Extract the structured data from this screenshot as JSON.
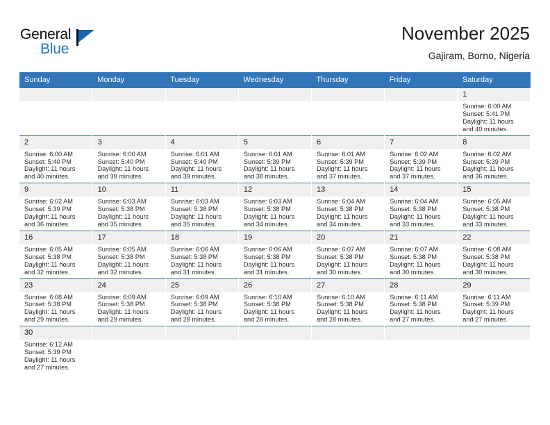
{
  "brand": {
    "name_primary": "General",
    "name_secondary": "Blue",
    "flag_icon": "flag-triangle-icon"
  },
  "header": {
    "title": "November 2025",
    "subtitle": "Gajiram, Borno, Nigeria"
  },
  "calendar": {
    "weekday_headers": [
      "Sunday",
      "Monday",
      "Tuesday",
      "Wednesday",
      "Thursday",
      "Friday",
      "Saturday"
    ],
    "accent_color": "#3275b8",
    "daynum_background": "#efefef",
    "weeks": [
      [
        {
          "day": "",
          "sunrise": "",
          "sunset": "",
          "daylight_line1": "",
          "daylight_line2": "",
          "empty": true
        },
        {
          "day": "",
          "sunrise": "",
          "sunset": "",
          "daylight_line1": "",
          "daylight_line2": "",
          "empty": true
        },
        {
          "day": "",
          "sunrise": "",
          "sunset": "",
          "daylight_line1": "",
          "daylight_line2": "",
          "empty": true
        },
        {
          "day": "",
          "sunrise": "",
          "sunset": "",
          "daylight_line1": "",
          "daylight_line2": "",
          "empty": true
        },
        {
          "day": "",
          "sunrise": "",
          "sunset": "",
          "daylight_line1": "",
          "daylight_line2": "",
          "empty": true
        },
        {
          "day": "",
          "sunrise": "",
          "sunset": "",
          "daylight_line1": "",
          "daylight_line2": "",
          "empty": true
        },
        {
          "day": "1",
          "sunrise": "Sunrise: 6:00 AM",
          "sunset": "Sunset: 5:41 PM",
          "daylight_line1": "Daylight: 11 hours",
          "daylight_line2": "and 40 minutes.",
          "empty": false
        }
      ],
      [
        {
          "day": "2",
          "sunrise": "Sunrise: 6:00 AM",
          "sunset": "Sunset: 5:40 PM",
          "daylight_line1": "Daylight: 11 hours",
          "daylight_line2": "and 40 minutes.",
          "empty": false
        },
        {
          "day": "3",
          "sunrise": "Sunrise: 6:00 AM",
          "sunset": "Sunset: 5:40 PM",
          "daylight_line1": "Daylight: 11 hours",
          "daylight_line2": "and 39 minutes.",
          "empty": false
        },
        {
          "day": "4",
          "sunrise": "Sunrise: 6:01 AM",
          "sunset": "Sunset: 5:40 PM",
          "daylight_line1": "Daylight: 11 hours",
          "daylight_line2": "and 39 minutes.",
          "empty": false
        },
        {
          "day": "5",
          "sunrise": "Sunrise: 6:01 AM",
          "sunset": "Sunset: 5:39 PM",
          "daylight_line1": "Daylight: 11 hours",
          "daylight_line2": "and 38 minutes.",
          "empty": false
        },
        {
          "day": "6",
          "sunrise": "Sunrise: 6:01 AM",
          "sunset": "Sunset: 5:39 PM",
          "daylight_line1": "Daylight: 11 hours",
          "daylight_line2": "and 37 minutes.",
          "empty": false
        },
        {
          "day": "7",
          "sunrise": "Sunrise: 6:02 AM",
          "sunset": "Sunset: 5:39 PM",
          "daylight_line1": "Daylight: 11 hours",
          "daylight_line2": "and 37 minutes.",
          "empty": false
        },
        {
          "day": "8",
          "sunrise": "Sunrise: 6:02 AM",
          "sunset": "Sunset: 5:39 PM",
          "daylight_line1": "Daylight: 11 hours",
          "daylight_line2": "and 36 minutes.",
          "empty": false
        }
      ],
      [
        {
          "day": "9",
          "sunrise": "Sunrise: 6:02 AM",
          "sunset": "Sunset: 5:39 PM",
          "daylight_line1": "Daylight: 11 hours",
          "daylight_line2": "and 36 minutes.",
          "empty": false
        },
        {
          "day": "10",
          "sunrise": "Sunrise: 6:03 AM",
          "sunset": "Sunset: 5:38 PM",
          "daylight_line1": "Daylight: 11 hours",
          "daylight_line2": "and 35 minutes.",
          "empty": false
        },
        {
          "day": "11",
          "sunrise": "Sunrise: 6:03 AM",
          "sunset": "Sunset: 5:38 PM",
          "daylight_line1": "Daylight: 11 hours",
          "daylight_line2": "and 35 minutes.",
          "empty": false
        },
        {
          "day": "12",
          "sunrise": "Sunrise: 6:03 AM",
          "sunset": "Sunset: 5:38 PM",
          "daylight_line1": "Daylight: 11 hours",
          "daylight_line2": "and 34 minutes.",
          "empty": false
        },
        {
          "day": "13",
          "sunrise": "Sunrise: 6:04 AM",
          "sunset": "Sunset: 5:38 PM",
          "daylight_line1": "Daylight: 11 hours",
          "daylight_line2": "and 34 minutes.",
          "empty": false
        },
        {
          "day": "14",
          "sunrise": "Sunrise: 6:04 AM",
          "sunset": "Sunset: 5:38 PM",
          "daylight_line1": "Daylight: 11 hours",
          "daylight_line2": "and 33 minutes.",
          "empty": false
        },
        {
          "day": "15",
          "sunrise": "Sunrise: 6:05 AM",
          "sunset": "Sunset: 5:38 PM",
          "daylight_line1": "Daylight: 11 hours",
          "daylight_line2": "and 33 minutes.",
          "empty": false
        }
      ],
      [
        {
          "day": "16",
          "sunrise": "Sunrise: 6:05 AM",
          "sunset": "Sunset: 5:38 PM",
          "daylight_line1": "Daylight: 11 hours",
          "daylight_line2": "and 32 minutes.",
          "empty": false
        },
        {
          "day": "17",
          "sunrise": "Sunrise: 6:05 AM",
          "sunset": "Sunset: 5:38 PM",
          "daylight_line1": "Daylight: 11 hours",
          "daylight_line2": "and 32 minutes.",
          "empty": false
        },
        {
          "day": "18",
          "sunrise": "Sunrise: 6:06 AM",
          "sunset": "Sunset: 5:38 PM",
          "daylight_line1": "Daylight: 11 hours",
          "daylight_line2": "and 31 minutes.",
          "empty": false
        },
        {
          "day": "19",
          "sunrise": "Sunrise: 6:06 AM",
          "sunset": "Sunset: 5:38 PM",
          "daylight_line1": "Daylight: 11 hours",
          "daylight_line2": "and 31 minutes.",
          "empty": false
        },
        {
          "day": "20",
          "sunrise": "Sunrise: 6:07 AM",
          "sunset": "Sunset: 5:38 PM",
          "daylight_line1": "Daylight: 11 hours",
          "daylight_line2": "and 30 minutes.",
          "empty": false
        },
        {
          "day": "21",
          "sunrise": "Sunrise: 6:07 AM",
          "sunset": "Sunset: 5:38 PM",
          "daylight_line1": "Daylight: 11 hours",
          "daylight_line2": "and 30 minutes.",
          "empty": false
        },
        {
          "day": "22",
          "sunrise": "Sunrise: 6:08 AM",
          "sunset": "Sunset: 5:38 PM",
          "daylight_line1": "Daylight: 11 hours",
          "daylight_line2": "and 30 minutes.",
          "empty": false
        }
      ],
      [
        {
          "day": "23",
          "sunrise": "Sunrise: 6:08 AM",
          "sunset": "Sunset: 5:38 PM",
          "daylight_line1": "Daylight: 11 hours",
          "daylight_line2": "and 29 minutes.",
          "empty": false
        },
        {
          "day": "24",
          "sunrise": "Sunrise: 6:09 AM",
          "sunset": "Sunset: 5:38 PM",
          "daylight_line1": "Daylight: 11 hours",
          "daylight_line2": "and 29 minutes.",
          "empty": false
        },
        {
          "day": "25",
          "sunrise": "Sunrise: 6:09 AM",
          "sunset": "Sunset: 5:38 PM",
          "daylight_line1": "Daylight: 11 hours",
          "daylight_line2": "and 28 minutes.",
          "empty": false
        },
        {
          "day": "26",
          "sunrise": "Sunrise: 6:10 AM",
          "sunset": "Sunset: 5:38 PM",
          "daylight_line1": "Daylight: 11 hours",
          "daylight_line2": "and 28 minutes.",
          "empty": false
        },
        {
          "day": "27",
          "sunrise": "Sunrise: 6:10 AM",
          "sunset": "Sunset: 5:38 PM",
          "daylight_line1": "Daylight: 11 hours",
          "daylight_line2": "and 28 minutes.",
          "empty": false
        },
        {
          "day": "28",
          "sunrise": "Sunrise: 6:11 AM",
          "sunset": "Sunset: 5:38 PM",
          "daylight_line1": "Daylight: 11 hours",
          "daylight_line2": "and 27 minutes.",
          "empty": false
        },
        {
          "day": "29",
          "sunrise": "Sunrise: 6:11 AM",
          "sunset": "Sunset: 5:39 PM",
          "daylight_line1": "Daylight: 11 hours",
          "daylight_line2": "and 27 minutes.",
          "empty": false
        }
      ],
      [
        {
          "day": "30",
          "sunrise": "Sunrise: 6:12 AM",
          "sunset": "Sunset: 5:39 PM",
          "daylight_line1": "Daylight: 11 hours",
          "daylight_line2": "and 27 minutes.",
          "empty": false
        },
        {
          "day": "",
          "sunrise": "",
          "sunset": "",
          "daylight_line1": "",
          "daylight_line2": "",
          "empty": true
        },
        {
          "day": "",
          "sunrise": "",
          "sunset": "",
          "daylight_line1": "",
          "daylight_line2": "",
          "empty": true
        },
        {
          "day": "",
          "sunrise": "",
          "sunset": "",
          "daylight_line1": "",
          "daylight_line2": "",
          "empty": true
        },
        {
          "day": "",
          "sunrise": "",
          "sunset": "",
          "daylight_line1": "",
          "daylight_line2": "",
          "empty": true
        },
        {
          "day": "",
          "sunrise": "",
          "sunset": "",
          "daylight_line1": "",
          "daylight_line2": "",
          "empty": true
        },
        {
          "day": "",
          "sunrise": "",
          "sunset": "",
          "daylight_line1": "",
          "daylight_line2": "",
          "empty": true
        }
      ]
    ]
  }
}
